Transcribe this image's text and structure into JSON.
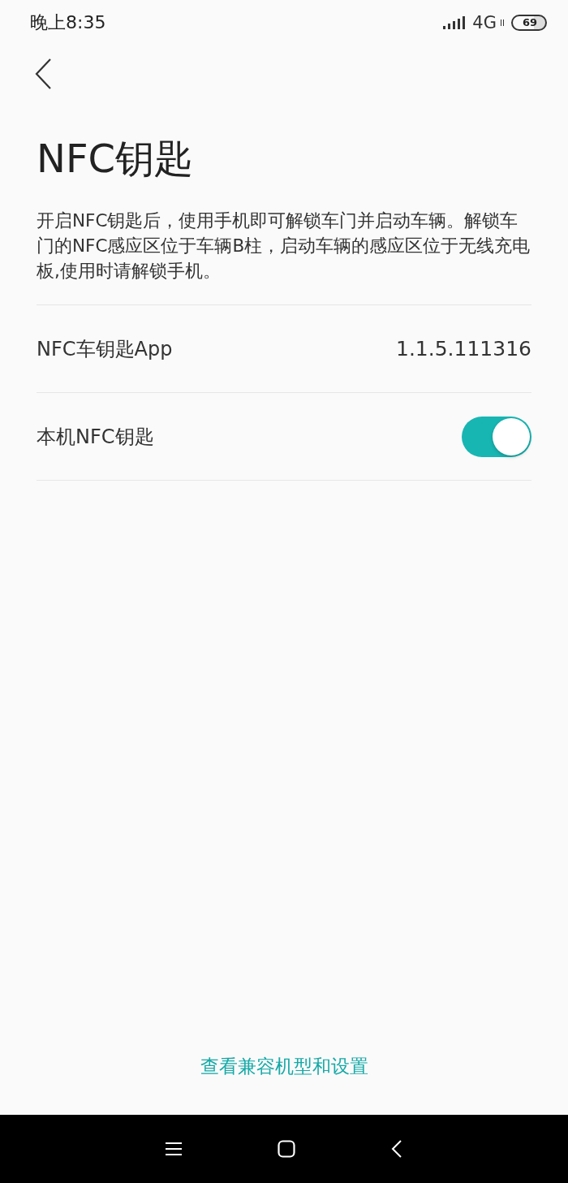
{
  "status_bar": {
    "time": "晚上8:35",
    "network": "4G",
    "battery": "69"
  },
  "title": "NFC钥匙",
  "description": "开启NFC钥匙后，使用手机即可解锁车门并启动车辆。解锁车门的NFC感应区位于车辆B柱，启动车辆的感应区位于无线充电板,使用时请解锁手机。",
  "settings": [
    {
      "kind": "info",
      "label": "NFC车钥匙App",
      "value": "1.1.5.111316"
    },
    {
      "kind": "switch",
      "label": "本机NFC钥匙",
      "on": true
    }
  ],
  "link": "查看兼容机型和设置"
}
